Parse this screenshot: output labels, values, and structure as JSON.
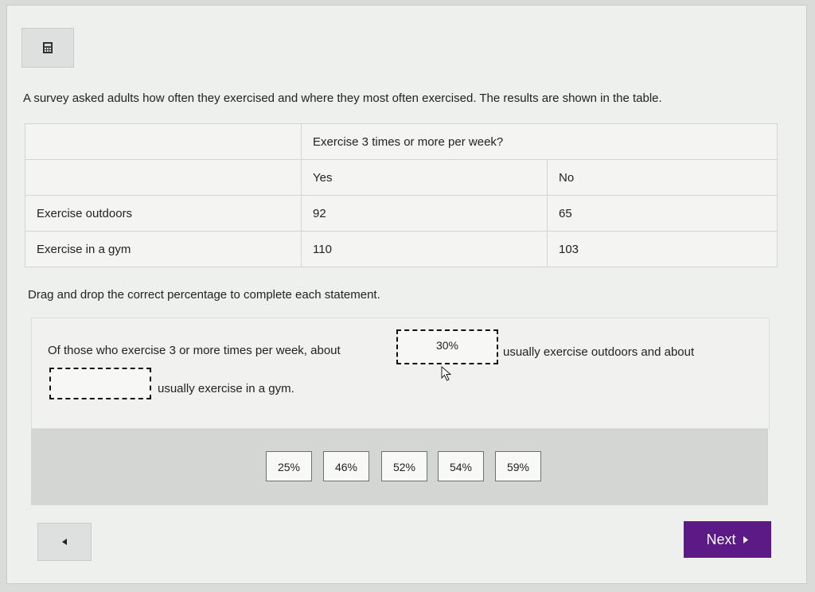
{
  "toolbar": {
    "calculator_icon": "calculator-icon"
  },
  "question": {
    "intro": "A survey asked adults how often they exercised and where they most often exercised. The results are shown in the table.",
    "table": {
      "header_group": "Exercise 3 times or more per week?",
      "col_yes": "Yes",
      "col_no": "No",
      "rows": [
        {
          "label": "Exercise outdoors",
          "yes": "92",
          "no": "65"
        },
        {
          "label": "Exercise in a gym",
          "yes": "110",
          "no": "103"
        }
      ]
    },
    "instruction": "Drag and drop the correct percentage to complete each statement."
  },
  "statement": {
    "part1": "Of those who exercise 3 or more times per week, about",
    "drop1_value": "30%",
    "part2": "usually exercise outdoors and about",
    "drop2_value": "",
    "part3": "usually exercise in a gym."
  },
  "options": [
    "25%",
    "46%",
    "52%",
    "54%",
    "59%"
  ],
  "nav": {
    "back_icon": "left-triangle-icon",
    "next_label": "Next",
    "next_icon": "right-triangle-icon",
    "next_color": "#5b1a86"
  }
}
